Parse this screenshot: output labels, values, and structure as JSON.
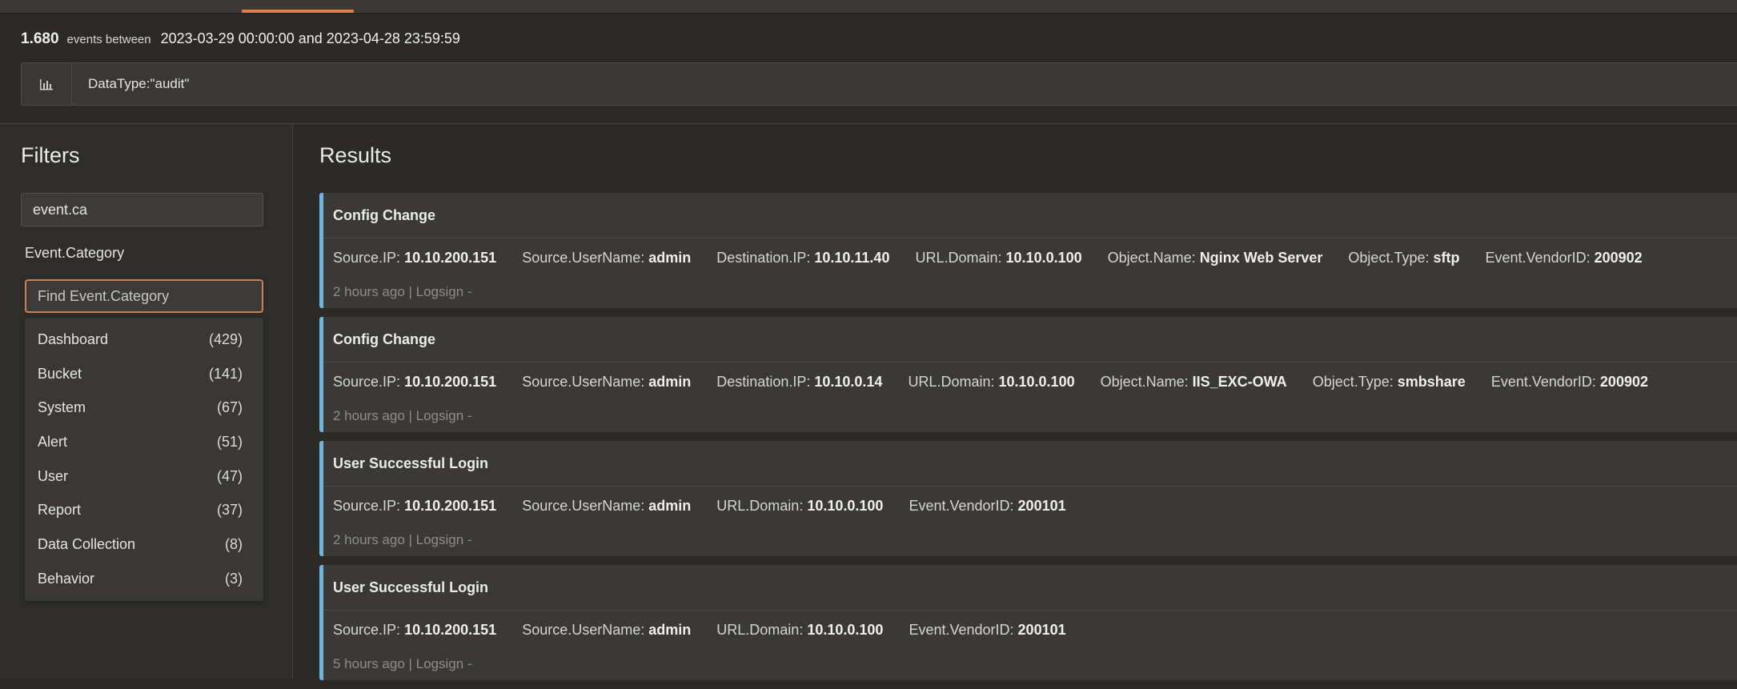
{
  "summary": {
    "count": "1.680",
    "between_label": "events between",
    "range": "2023-03-29 00:00:00 and 2023-04-28 23:59:59"
  },
  "query": {
    "value": "DataType:\"audit\""
  },
  "icons": {
    "chart": "bar-chart-icon"
  },
  "filters": {
    "title": "Filters",
    "search_value": "event.ca",
    "facet": {
      "title": "Event.Category",
      "find_placeholder": "Find Event.Category",
      "items": [
        {
          "label": "Dashboard",
          "count": "(429)"
        },
        {
          "label": "Bucket",
          "count": "(141)"
        },
        {
          "label": "System",
          "count": "(67)"
        },
        {
          "label": "Alert",
          "count": "(51)"
        },
        {
          "label": "User",
          "count": "(47)"
        },
        {
          "label": "Report",
          "count": "(37)"
        },
        {
          "label": "Data Collection",
          "count": "(8)"
        },
        {
          "label": "Behavior",
          "count": "(3)"
        }
      ]
    }
  },
  "results": {
    "title": "Results",
    "cards": [
      {
        "title": "Config Change",
        "fields": [
          {
            "key": "Source.IP:",
            "value": "10.10.200.151"
          },
          {
            "key": "Source.UserName:",
            "value": "admin"
          },
          {
            "key": "Destination.IP:",
            "value": "10.10.11.40"
          },
          {
            "key": "URL.Domain:",
            "value": "10.10.0.100"
          },
          {
            "key": "Object.Name:",
            "value": "Nginx Web Server"
          },
          {
            "key": "Object.Type:",
            "value": "sftp"
          },
          {
            "key": "Event.VendorID:",
            "value": "200902"
          }
        ],
        "meta": "2 hours ago | Logsign -"
      },
      {
        "title": "Config Change",
        "fields": [
          {
            "key": "Source.IP:",
            "value": "10.10.200.151"
          },
          {
            "key": "Source.UserName:",
            "value": "admin"
          },
          {
            "key": "Destination.IP:",
            "value": "10.10.0.14"
          },
          {
            "key": "URL.Domain:",
            "value": "10.10.0.100"
          },
          {
            "key": "Object.Name:",
            "value": "IIS_EXC-OWA"
          },
          {
            "key": "Object.Type:",
            "value": "smbshare"
          },
          {
            "key": "Event.VendorID:",
            "value": "200902"
          }
        ],
        "meta": "2 hours ago | Logsign -"
      },
      {
        "title": "User Successful Login",
        "fields": [
          {
            "key": "Source.IP:",
            "value": "10.10.200.151"
          },
          {
            "key": "Source.UserName:",
            "value": "admin"
          },
          {
            "key": "URL.Domain:",
            "value": "10.10.0.100"
          },
          {
            "key": "Event.VendorID:",
            "value": "200101"
          }
        ],
        "meta": "2 hours ago | Logsign -"
      },
      {
        "title": "User Successful Login",
        "fields": [
          {
            "key": "Source.IP:",
            "value": "10.10.200.151"
          },
          {
            "key": "Source.UserName:",
            "value": "admin"
          },
          {
            "key": "URL.Domain:",
            "value": "10.10.0.100"
          },
          {
            "key": "Event.VendorID:",
            "value": "200101"
          }
        ],
        "meta": "5 hours ago | Logsign -"
      }
    ]
  }
}
